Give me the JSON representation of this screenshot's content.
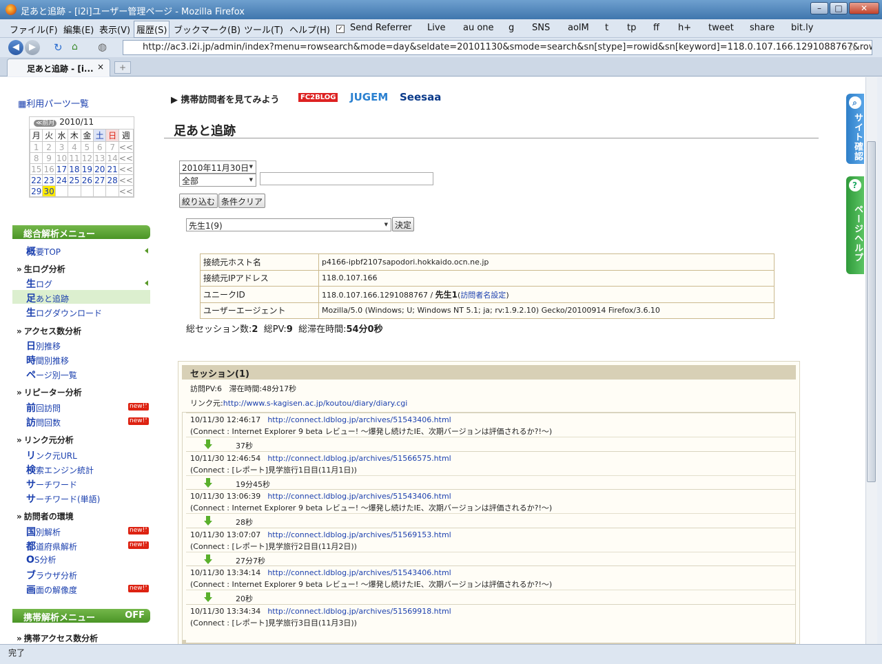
{
  "window": {
    "title": "足あと追跡 - [i2i]ユーザー管理ページ - Mozilla Firefox",
    "min": "–",
    "max": "□",
    "close": "✕"
  },
  "menu": [
    "ファイル(F)",
    "編集(E)",
    "表示(V)",
    "履歴(S)",
    "ブックマーク(B)",
    "ツール(T)",
    "ヘルプ(H)"
  ],
  "toolbar_links": [
    "Send Referrer",
    "Live",
    "au one",
    "g",
    "SNS",
    "aolM",
    "t",
    "tp",
    "ff",
    "h+",
    "tweet",
    "share",
    "bit.ly"
  ],
  "url": "http://ac3.i2i.jp/admin/index?menu=rowsearch&mode=day&seldate=20101130&smode=search&sn[stype]=rowid&sn[keyword]=118.0.107.166.1291088767&rowmode=uniq",
  "tab": {
    "title": "足あと追跡 - [i...",
    "close": "×",
    "new": "+"
  },
  "status": "完了",
  "sidebar": {
    "parts_list": "利用パーツ一覧",
    "calendar": {
      "prev": "≪前月",
      "month": "2010/11",
      "headers": [
        "月",
        "火",
        "水",
        "木",
        "金",
        "土",
        "日",
        "週"
      ],
      "rows": [
        [
          "1",
          "2",
          "3",
          "4",
          "5",
          "6",
          "7",
          "<<"
        ],
        [
          "8",
          "9",
          "10",
          "11",
          "12",
          "13",
          "14",
          "<<"
        ],
        [
          "15",
          "16",
          "17",
          "18",
          "19",
          "20",
          "21",
          "<<"
        ],
        [
          "22",
          "23",
          "24",
          "25",
          "26",
          "27",
          "28",
          "<<"
        ],
        [
          "29",
          "30",
          "",
          "",
          "",
          "",
          "",
          "<<"
        ]
      ]
    },
    "menu_head": "総合解析メニュー",
    "overview_b": "概",
    "overview": "要TOP",
    "sec_raw": "生ログ分析",
    "raw_b": "生",
    "raw": "ログ",
    "track_b": "足",
    "track": "あと追跡",
    "dl_b": "生",
    "dl": "ログダウンロード",
    "sec_access": "アクセス数分析",
    "day_b": "日",
    "day": "別推移",
    "time_b": "時",
    "time": "間別推移",
    "page_b": "ペ",
    "page": "ージ別一覧",
    "sec_repeat": "リピーター分析",
    "prev_b": "前",
    "prev": "回訪問",
    "count_b": "訪",
    "count": "問回数",
    "sec_link": "リンク元分析",
    "url_b": "リ",
    "url": "ンク元URL",
    "engine_b": "検",
    "engine": "索エンジン統計",
    "kw_b": "サ",
    "kw": "ーチワード",
    "kw1_b": "サ",
    "kw1": "ーチワード(単語)",
    "sec_env": "訪問者の環境",
    "country_b": "国",
    "country": "別解析",
    "pref_b": "都",
    "pref": "道府県解析",
    "os_b": "O",
    "os": "S分析",
    "browser_b": "ブ",
    "browser": "ラウザ分析",
    "screen_b": "画",
    "screen": "面の解像度",
    "mobile_head": "携帯解析メニュー",
    "mobile_off": "OFF",
    "sec_mobile": "携帯アクセス数分析",
    "new": "new!!"
  },
  "banner": {
    "text": "携帯訪問者を見てみよう",
    "fc2": "FC2BLOG",
    "jugem": "JUGEM",
    "seesaa": "Seesaa"
  },
  "page_title": "足あと追跡",
  "filters": {
    "date": "2010年11月30日",
    "kind": "全部",
    "keyword": "",
    "narrow": "絞り込む",
    "clear": "条件クリア",
    "visitor": "先生1(9)",
    "decide": "決定"
  },
  "info": {
    "rows": [
      {
        "k": "接続元ホスト名",
        "v": "p4166-ipbf2107sapodori.hokkaido.ocn.ne.jp"
      },
      {
        "k": "接続元IPアドレス",
        "v": "118.0.107.166"
      },
      {
        "k": "ユニークID",
        "v": "118.0.107.166.1291088767 / ",
        "v2": "先生1",
        "v3": "(",
        "link": "訪問者名設定",
        "v4": ")"
      },
      {
        "k": "ユーザーエージェント",
        "v": "Mozilla/5.0 (Windows; U; Windows NT 5.1; ja; rv:1.9.2.10) Gecko/20100914 Firefox/3.6.10"
      }
    ]
  },
  "summary": {
    "sessions_l": "総セッション数:",
    "sessions": "2",
    "pv_l": "総PV:",
    "pv": "9",
    "time_l": "総滞在時間:",
    "time": "54分0秒"
  },
  "session": {
    "title": "セッション(1)",
    "pv_l": "訪問PV:",
    "pv": "6",
    "stay_l": "滞在時間:",
    "stay": "48分17秒",
    "ref_l": "リンク元:",
    "ref": "http://www.s-kagisen.ac.jp/koutou/diary/diary.cgi",
    "visits": [
      {
        "time": "10/11/30 12:46:17",
        "url": "http://connect.ldblog.jp/archives/51543406.html",
        "title": "(Connect : Internet Explorer 9 beta レビュー! 〜爆発し続けたIE、次期バージョンは評価されるか?!〜)",
        "gap": "37秒"
      },
      {
        "time": "10/11/30 12:46:54",
        "url": "http://connect.ldblog.jp/archives/51566575.html",
        "title": "(Connect : [レポート]見学旅行1日目(11月1日))",
        "gap": "19分45秒"
      },
      {
        "time": "10/11/30 13:06:39",
        "url": "http://connect.ldblog.jp/archives/51543406.html",
        "title": "(Connect : Internet Explorer 9 beta レビュー! 〜爆発し続けたIE、次期バージョンは評価されるか?!〜)",
        "gap": "28秒"
      },
      {
        "time": "10/11/30 13:07:07",
        "url": "http://connect.ldblog.jp/archives/51569153.html",
        "title": "(Connect : [レポート]見学旅行2日目(11月2日))",
        "gap": "27分7秒"
      },
      {
        "time": "10/11/30 13:34:14",
        "url": "http://connect.ldblog.jp/archives/51543406.html",
        "title": "(Connect : Internet Explorer 9 beta レビュー! 〜爆発し続けたIE、次期バージョンは評価されるか?!〜)",
        "gap": "20秒"
      },
      {
        "time": "10/11/30 13:34:34",
        "url": "http://connect.ldblog.jp/archives/51569918.html",
        "title": "(Connect : [レポート]見学旅行3日目(11月3日))",
        "gap": ""
      }
    ]
  },
  "side_tabs": {
    "site": "サイト確認",
    "help": "ページヘルプ",
    "site_icon": "search-icon",
    "help_icon": "?"
  }
}
